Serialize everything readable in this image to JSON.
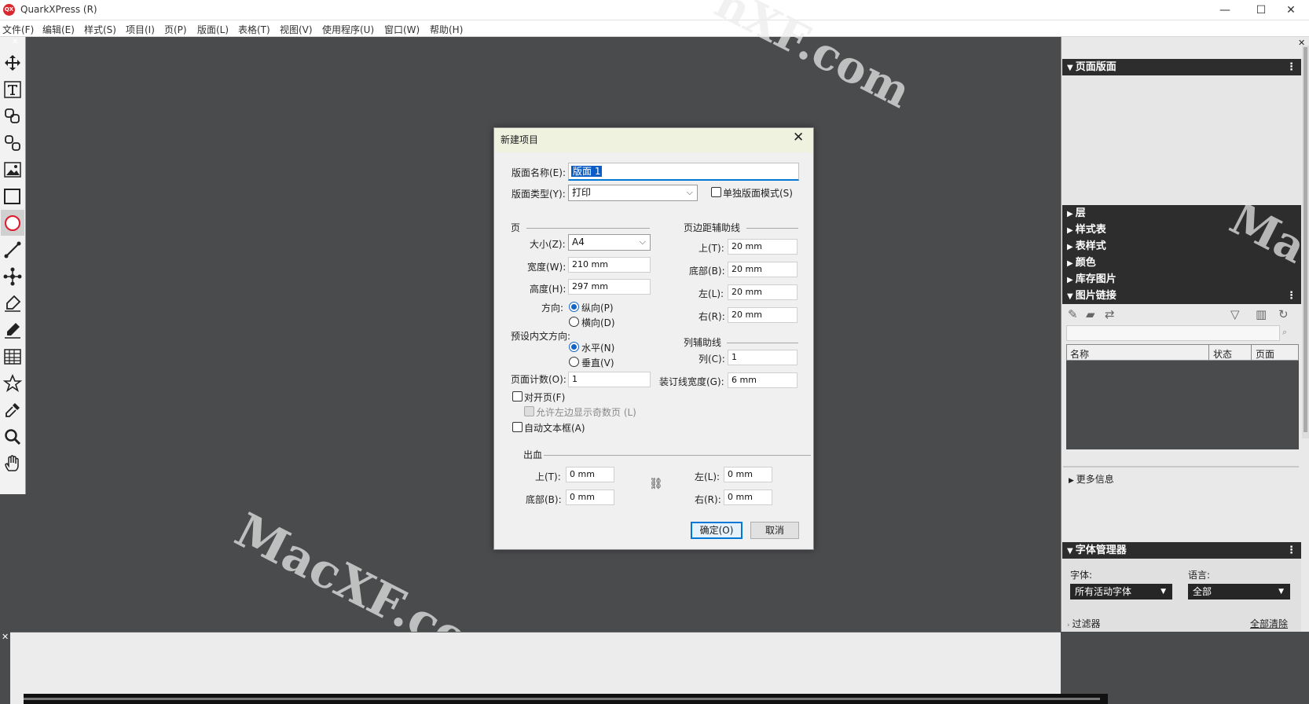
{
  "app": {
    "title": "QuarkXPress (R)",
    "logo_text": "QX",
    "window_controls": {
      "minimize": "—",
      "maximize": "☐",
      "close": "✕"
    }
  },
  "menu": {
    "items": [
      "文件(F)",
      "编辑(E)",
      "样式(S)",
      "项目(I)",
      "页(P)",
      "版面(L)",
      "表格(T)",
      "视图(V)",
      "使用程序(U)",
      "窗口(W)",
      "帮助(H)"
    ]
  },
  "tools": [
    "move-tool",
    "text-content-tool",
    "text-linking-tool",
    "text-unlinking-tool",
    "picture-content-tool",
    "rectangle-box-tool",
    "oval-box-tool",
    "line-tool",
    "bezier-pen-tool",
    "pen-edit-tool",
    "freehand-pencil-tool",
    "table-tool",
    "starburst-tool",
    "eyedropper-tool",
    "zoom-tool",
    "hand-tool"
  ],
  "watermark": {
    "text": "MacXF.com",
    "partial_top": "nXF.com",
    "partial_right": "Ma"
  },
  "dialog": {
    "title": "新建项目",
    "close": "✕",
    "layout_name_label": "版面名称(E):",
    "layout_name_value": "版面 1",
    "layout_type_label": "版面类型(Y):",
    "layout_type_value": "打印",
    "single_layout_label": "单独版面模式(S)",
    "page_section": "页",
    "size_label": "大小(Z):",
    "size_value": "A4",
    "width_label": "宽度(W):",
    "width_value": "210 mm",
    "height_label": "高度(H):",
    "height_value": "297 mm",
    "orientation_label": "方向:",
    "portrait_label": "纵向(P)",
    "landscape_label": "横向(D)",
    "story_dir_label": "预设内文方向:",
    "horizontal_label": "水平(N)",
    "vertical_label": "垂直(V)",
    "page_count_label": "页面计数(O):",
    "page_count_value": "1",
    "facing_pages_label": "对开页(F)",
    "allow_odd_left_label": "允许左边显示奇数页 (L)",
    "auto_text_box_label": "自动文本框(A)",
    "margin_section": "页边距辅助线",
    "margin_top_label": "上(T):",
    "margin_top_value": "20 mm",
    "margin_bottom_label": "底部(B):",
    "margin_bottom_value": "20 mm",
    "margin_left_label": "左(L):",
    "margin_left_value": "20 mm",
    "margin_right_label": "右(R):",
    "margin_right_value": "20 mm",
    "column_section": "列辅助线",
    "columns_label": "列(C):",
    "columns_value": "1",
    "gutter_label": "装订线宽度(G):",
    "gutter_value": "6 mm",
    "bleed_section": "出血",
    "bleed_top_label": "上(T):",
    "bleed_top_value": "0 mm",
    "bleed_bottom_label": "底部(B):",
    "bleed_bottom_value": "0 mm",
    "bleed_left_label": "左(L):",
    "bleed_left_value": "0 mm",
    "bleed_right_label": "右(R):",
    "bleed_right_value": "0 mm",
    "ok": "确定(O)",
    "cancel": "取消"
  },
  "right_panel": {
    "page_layout": "页面版面",
    "layers": "层",
    "style_sheets": "样式表",
    "table_styles": "表样式",
    "colors": "颜色",
    "image_library": "库存图片",
    "picture_links": "图片链接",
    "links_columns": [
      "名称",
      "状态",
      "页面"
    ],
    "more_info": "更多信息",
    "font_manager": "字体管理器",
    "font_label": "字体:",
    "font_value": "所有活动字体",
    "language_label": "语言:",
    "language_value": "全部",
    "filter_label": "过滤器",
    "clear_all": "全部清除"
  }
}
